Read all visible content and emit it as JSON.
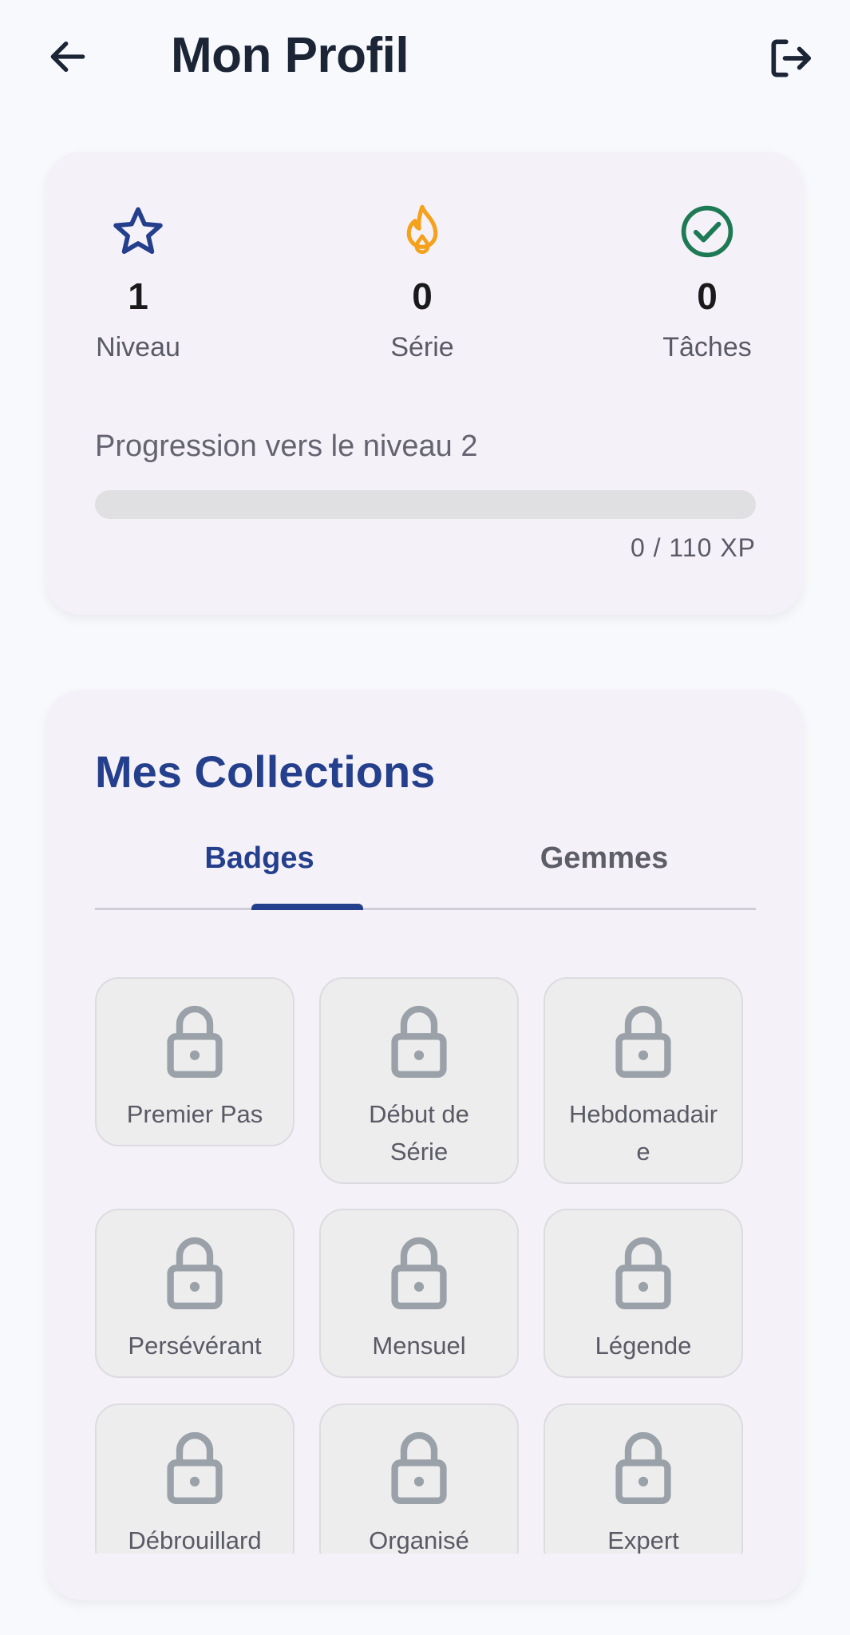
{
  "header": {
    "title": "Mon Profil",
    "back_icon": "arrow-left-icon",
    "logout_icon": "logout-icon"
  },
  "stats": {
    "level": {
      "value": "1",
      "label": "Niveau",
      "icon": "star-icon",
      "color": "#243f8c"
    },
    "streak": {
      "value": "0",
      "label": "Série",
      "icon": "flame-icon",
      "color": "#f5a11c"
    },
    "tasks": {
      "value": "0",
      "label": "Tâches",
      "icon": "check-circle-icon",
      "color": "#1e7a55"
    }
  },
  "progress": {
    "label": "Progression vers le niveau 2",
    "xp_text": "0 / 110 XP",
    "fraction": 0
  },
  "collections": {
    "title": "Mes Collections",
    "tabs": [
      {
        "label": "Badges",
        "active": true
      },
      {
        "label": "Gemmes",
        "active": false
      }
    ],
    "badges": [
      {
        "name": "Premier Pas",
        "locked": true
      },
      {
        "name": "Début de Série",
        "locked": true
      },
      {
        "name": "Hebdomadaire",
        "locked": true
      },
      {
        "name": "Persévérant",
        "locked": true
      },
      {
        "name": "Mensuel",
        "locked": true
      },
      {
        "name": "Légende",
        "locked": true
      },
      {
        "name": "Débrouillard",
        "locked": true
      },
      {
        "name": "Organisé",
        "locked": true
      },
      {
        "name": "Expert",
        "locked": true
      }
    ]
  },
  "colors": {
    "primary": "#243f8c",
    "background": "#f8f9fc",
    "card": "#f5f1f9",
    "lock": "#9aa1a8"
  }
}
